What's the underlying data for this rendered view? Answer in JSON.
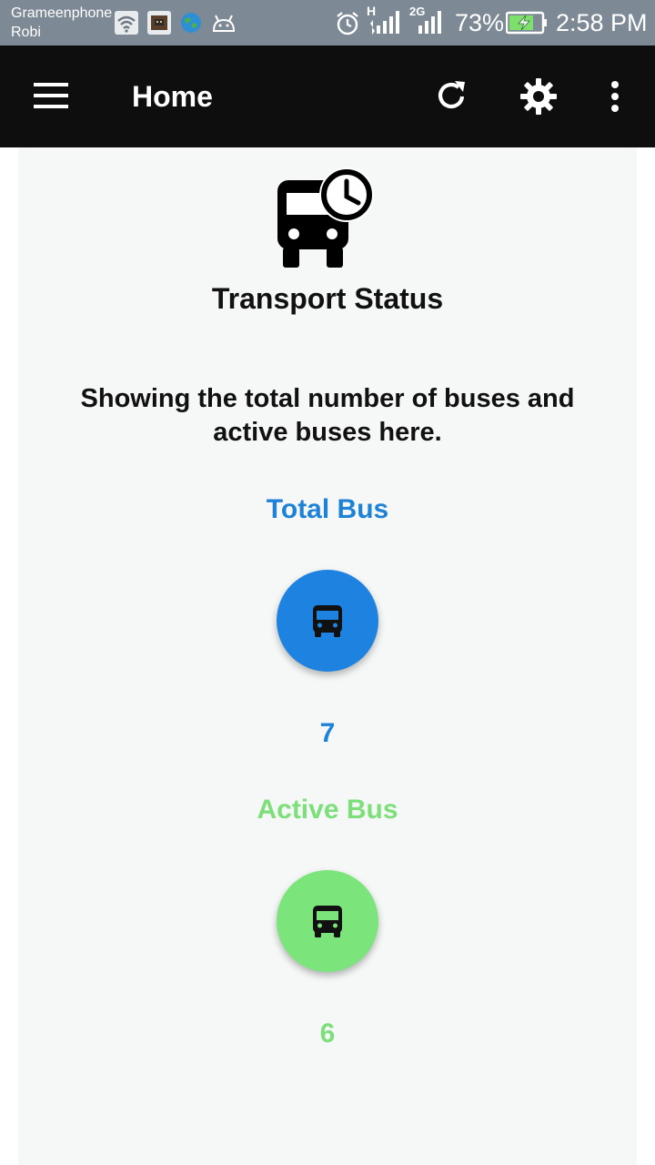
{
  "status_bar": {
    "carrier_1": "Grameenphone",
    "carrier_2": "Robi",
    "network_h": "H",
    "network_2g": "2G",
    "battery": "73%",
    "time": "2:58 PM"
  },
  "app_bar": {
    "title": "Home",
    "icons": [
      "menu-icon",
      "refresh-icon",
      "settings-icon",
      "more-vert-icon"
    ],
    "background": "#0e0e0e"
  },
  "main": {
    "hero_icon": "bus-clock-icon",
    "heading": "Transport Status",
    "description": "Showing the total number of buses and active buses here.",
    "total": {
      "label": "Total Bus",
      "count": "7",
      "color": "#1e82d6",
      "icon": "bus-icon"
    },
    "active": {
      "label": "Active Bus",
      "count": "6",
      "color": "#7ddf79",
      "icon": "bus-icon"
    }
  }
}
